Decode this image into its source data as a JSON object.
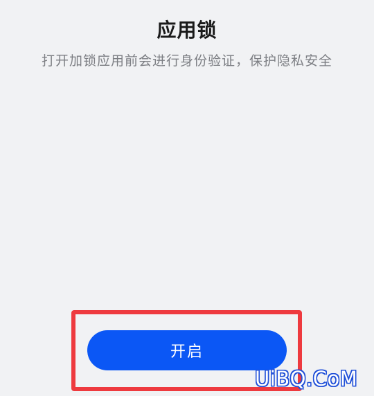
{
  "page": {
    "title": "应用锁",
    "description": "打开加锁应用前会进行身份验证，保护隐私安全"
  },
  "actions": {
    "enable_label": "开启"
  },
  "watermark": {
    "text": "UiBQ.CoM"
  },
  "colors": {
    "background": "#f1f2f4",
    "primary": "#0b57f5",
    "highlight": "#ee3a3f",
    "subtitle": "#7d7f84"
  }
}
